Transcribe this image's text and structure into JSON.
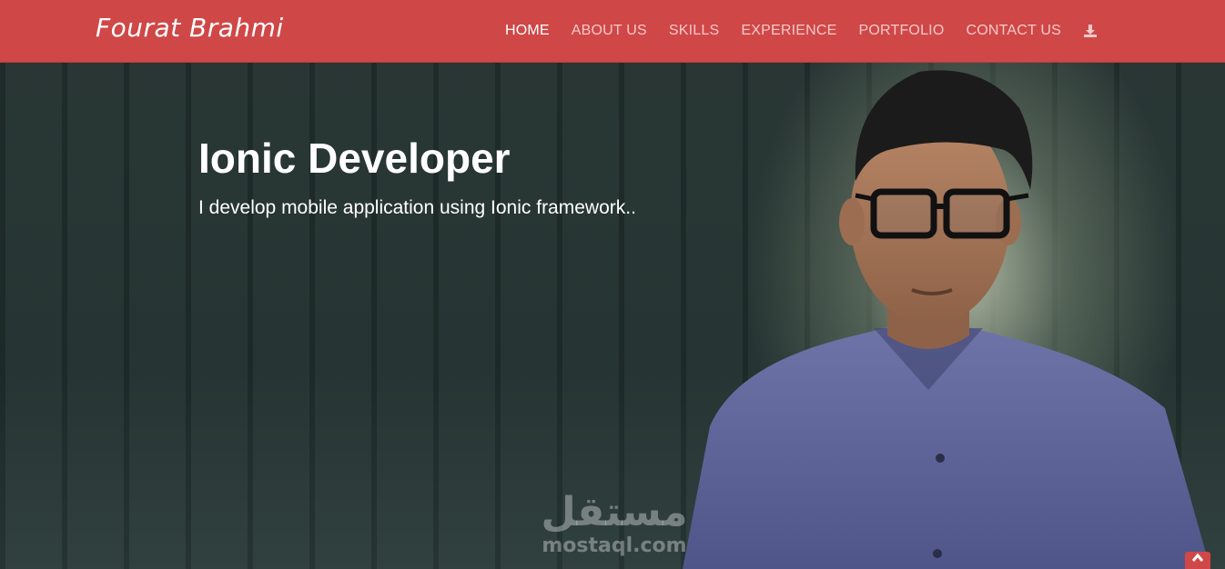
{
  "header": {
    "brand": "Fourat Brahmi",
    "nav": [
      {
        "label": "HOME",
        "active": true
      },
      {
        "label": "ABOUT US",
        "active": false
      },
      {
        "label": "SKILLS",
        "active": false
      },
      {
        "label": "EXPERIENCE",
        "active": false
      },
      {
        "label": "PORTFOLIO",
        "active": false
      },
      {
        "label": "CONTACT US",
        "active": false
      }
    ],
    "download_icon": "download-icon"
  },
  "hero": {
    "title": "Ionic Developer",
    "subtitle": "I develop mobile application using Ionic framework.."
  },
  "watermark": {
    "arabic": "مستقل",
    "latin": "mostaql.com"
  },
  "back_to_top_icon": "chevron-up-icon",
  "colors": {
    "primary": "#d04747",
    "nav_active": "#ffffff",
    "nav_inactive": "#f4c9c9"
  }
}
